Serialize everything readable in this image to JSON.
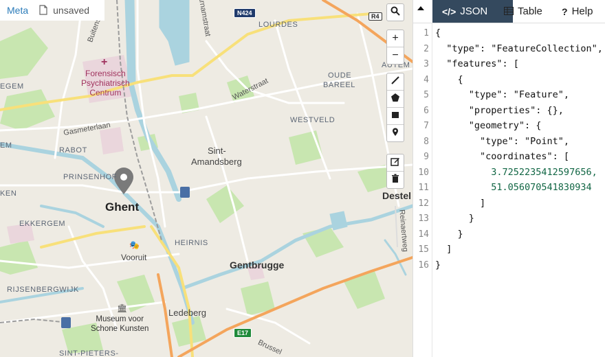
{
  "meta_bar": {
    "meta_label": "Meta",
    "status": "unsaved"
  },
  "map": {
    "labels": {
      "ghent": "Ghent",
      "sint_amandsberg_1": "Sint-",
      "sint_amandsberg_2": "Amandsberg",
      "gentbrugge": "Gentbrugge",
      "ledeberg": "Ledeberg",
      "destel": "Destel",
      "lourdes": "LOURDES",
      "oude_bareel_1": "OUDE",
      "oude_bareel_2": "BAREEL",
      "westveld": "WESTVELD",
      "rabot": "RABOT",
      "prinsenhof": "PRINSENHOF",
      "ekkergem": "EKKERGEM",
      "heirnis": "HEIRNIS",
      "vooruit": "Vooruit",
      "rijsenbergwijk": "RIJSENBERGWIJK",
      "sint_pieters": "SINT-PIETERS-",
      "egem": "EGEM",
      "em": "EM",
      "ken": "KEN",
      "autem": "AUTEM",
      "forensisch_1": "Forensisch",
      "forensisch_2": "Psychiatrisch",
      "forensisch_3": "Centrum",
      "museum_1": "Museum voor",
      "museum_2": "Schone Kunsten",
      "gasmeterlaan": "Gasmeterlaan",
      "waterstraat": "Waterstraat",
      "buitensel": "Buitensel",
      "arnamstraat": "arnamstraat",
      "reinaertweg": "Reinaertweg",
      "brussel": "Brussel",
      "n424": "N424",
      "r4": "R4",
      "e17": "E17"
    },
    "controls": {
      "search": "search-icon",
      "zoom_in": "+",
      "zoom_out": "−",
      "draw_line": "line-icon",
      "draw_polygon": "polygon-icon",
      "draw_rectangle": "rectangle-icon",
      "draw_marker": "marker-icon",
      "edit": "edit-icon",
      "delete": "trash-icon"
    },
    "colors": {
      "water": "#aad3df",
      "park": "#c8e6b0",
      "road_major": "#f7b06b",
      "road_yellow": "#f8e07a",
      "marker": "#7a7a7a"
    }
  },
  "pane": {
    "tabs": [
      {
        "label": "JSON",
        "icon": "</>"
      },
      {
        "label": "Table",
        "icon": "table-icon"
      },
      {
        "label": "Help",
        "icon": "?"
      }
    ],
    "line_numbers": [
      "1",
      "2",
      "3",
      "4",
      "5",
      "6",
      "7",
      "8",
      "9",
      "10",
      "11",
      "12",
      "13",
      "14",
      "15",
      "16"
    ],
    "code_lines": [
      "{",
      "  \"type\": \"FeatureCollection\",",
      "  \"features\": [",
      "    {",
      "      \"type\": \"Feature\",",
      "      \"properties\": {},",
      "      \"geometry\": {",
      "        \"type\": \"Point\",",
      "        \"coordinates\": [",
      "          3.7252235412597656,",
      "          51.056070541830934",
      "        ]",
      "      }",
      "    }",
      "  ]",
      "}"
    ]
  }
}
